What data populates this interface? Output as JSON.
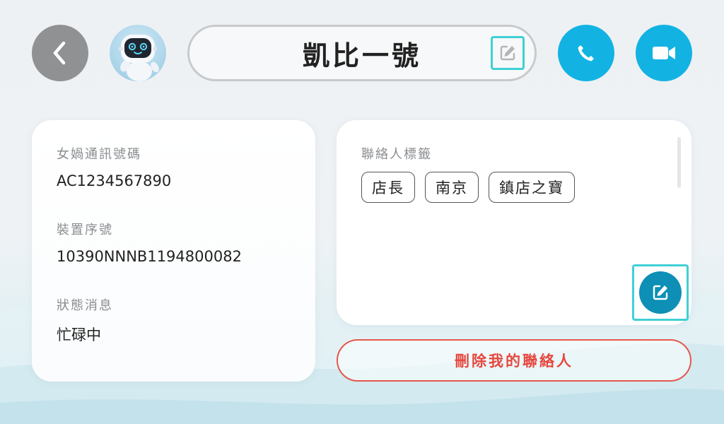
{
  "header": {
    "contact_name": "凱比一號"
  },
  "info": {
    "items": [
      {
        "label": "女媧通訊號碼",
        "value": "AC1234567890"
      },
      {
        "label": "裝置序號",
        "value": "10390NNNB1194800082"
      },
      {
        "label": "狀態消息",
        "value": "忙碌中"
      }
    ]
  },
  "tags": {
    "label": "聯絡人標籤",
    "items": [
      "店長",
      "南京",
      "鎮店之寶"
    ]
  },
  "delete_label": "刪除我的聯絡人",
  "icons": {
    "back": "chevron-left-icon",
    "call": "phone-icon",
    "video": "video-camera-icon",
    "edit": "edit-icon"
  },
  "colors": {
    "accent": "#12b3e3",
    "edit_button": "#0e8fb6",
    "danger": "#e5473d",
    "focus_outline": "#3fd0d6",
    "back_button": "#8f9192"
  }
}
